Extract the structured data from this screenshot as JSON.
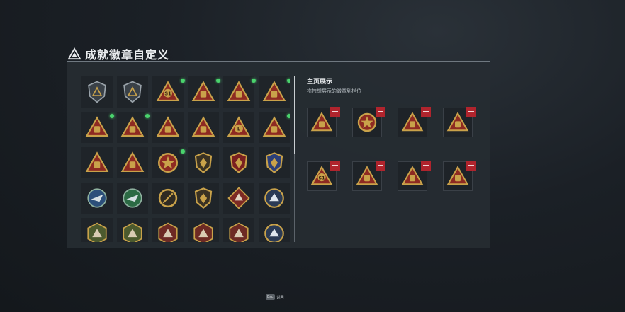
{
  "header": {
    "title": "成就徽章自定义",
    "icon": "triangle-emblem-icon"
  },
  "grid": {
    "rows": [
      [
        {
          "icon": "triangle-emblem-icon",
          "kind": "shield-dark",
          "new": false
        },
        {
          "icon": "helicopter-icon",
          "kind": "shield-dark",
          "new": false
        },
        {
          "icon": "s1-badge-icon",
          "kind": "tri",
          "new": true,
          "label": "S1"
        },
        {
          "icon": "tri-badge-icon",
          "kind": "tri",
          "new": true
        },
        {
          "icon": "tri-badge-icon",
          "kind": "tri",
          "new": true
        },
        {
          "icon": "tri-badge-icon",
          "kind": "tri",
          "new": true
        }
      ],
      [
        {
          "icon": "tri-badge-icon",
          "kind": "tri",
          "new": true
        },
        {
          "icon": "tri-badge-icon",
          "kind": "tri",
          "new": true
        },
        {
          "icon": "tri-badge-icon",
          "kind": "tri",
          "new": false
        },
        {
          "icon": "boat-badge-icon",
          "kind": "tri",
          "new": false
        },
        {
          "icon": "l-badge-icon",
          "kind": "tri",
          "new": false,
          "label": "L"
        },
        {
          "icon": "tri-badge-icon",
          "kind": "tri",
          "new": true
        }
      ],
      [
        {
          "icon": "tri-badge-icon",
          "kind": "tri",
          "new": false
        },
        {
          "icon": "tri-badge-icon",
          "kind": "tri",
          "new": false
        },
        {
          "icon": "star-medal-icon",
          "kind": "medal",
          "new": true
        },
        {
          "icon": "shield-badge-icon",
          "kind": "shield",
          "new": false
        },
        {
          "icon": "shield-badge-icon",
          "kind": "shield-red",
          "new": false
        },
        {
          "icon": "shield-badge-icon",
          "kind": "shield-blue",
          "new": false
        }
      ],
      [
        {
          "icon": "eagle-badge-icon",
          "kind": "wreath-blue",
          "new": false
        },
        {
          "icon": "eagle-badge-icon",
          "kind": "wreath-green",
          "new": false
        },
        {
          "icon": "ring-badge-icon",
          "kind": "ring",
          "new": false
        },
        {
          "icon": "eagle-badge-icon",
          "kind": "shield",
          "new": false
        },
        {
          "icon": "wolf-badge-icon",
          "kind": "diamond-red",
          "new": false
        },
        {
          "icon": "wolf-badge-icon",
          "kind": "circle",
          "new": false
        }
      ],
      [
        {
          "icon": "beast-badge-icon",
          "kind": "hex-green",
          "new": false
        },
        {
          "icon": "beast-badge-icon",
          "kind": "hex-green",
          "new": false
        },
        {
          "icon": "beast-badge-icon",
          "kind": "hex-red",
          "new": false
        },
        {
          "icon": "beast-badge-icon",
          "kind": "hex-red",
          "new": false
        },
        {
          "icon": "beast-badge-icon",
          "kind": "hex-red",
          "new": false
        },
        {
          "icon": "beast-badge-icon",
          "kind": "circle",
          "new": false
        }
      ]
    ]
  },
  "showcase": {
    "title": "主页展示",
    "subtitle": "拖拽想展示的徽章到栏位",
    "slots": [
      {
        "icon": "tri-badge-icon",
        "kind": "tri"
      },
      {
        "icon": "star-medal-icon",
        "kind": "medal"
      },
      {
        "icon": "tri-badge-icon",
        "kind": "tri"
      },
      {
        "icon": "tri-badge-icon",
        "kind": "tri"
      },
      {
        "icon": "s1-badge-icon",
        "kind": "tri",
        "label": "S1"
      },
      {
        "icon": "tri-badge-icon",
        "kind": "tri"
      },
      {
        "icon": "tri-badge-icon",
        "kind": "tri"
      },
      {
        "icon": "tri-badge-icon",
        "kind": "tri"
      }
    ]
  },
  "footer": {
    "esc_label": "Esc",
    "back_label": "返回"
  },
  "colors": {
    "gold": "#c9a24a",
    "red": "#8e2a22",
    "new_dot": "#4ad36d",
    "remove": "#b0242d"
  }
}
